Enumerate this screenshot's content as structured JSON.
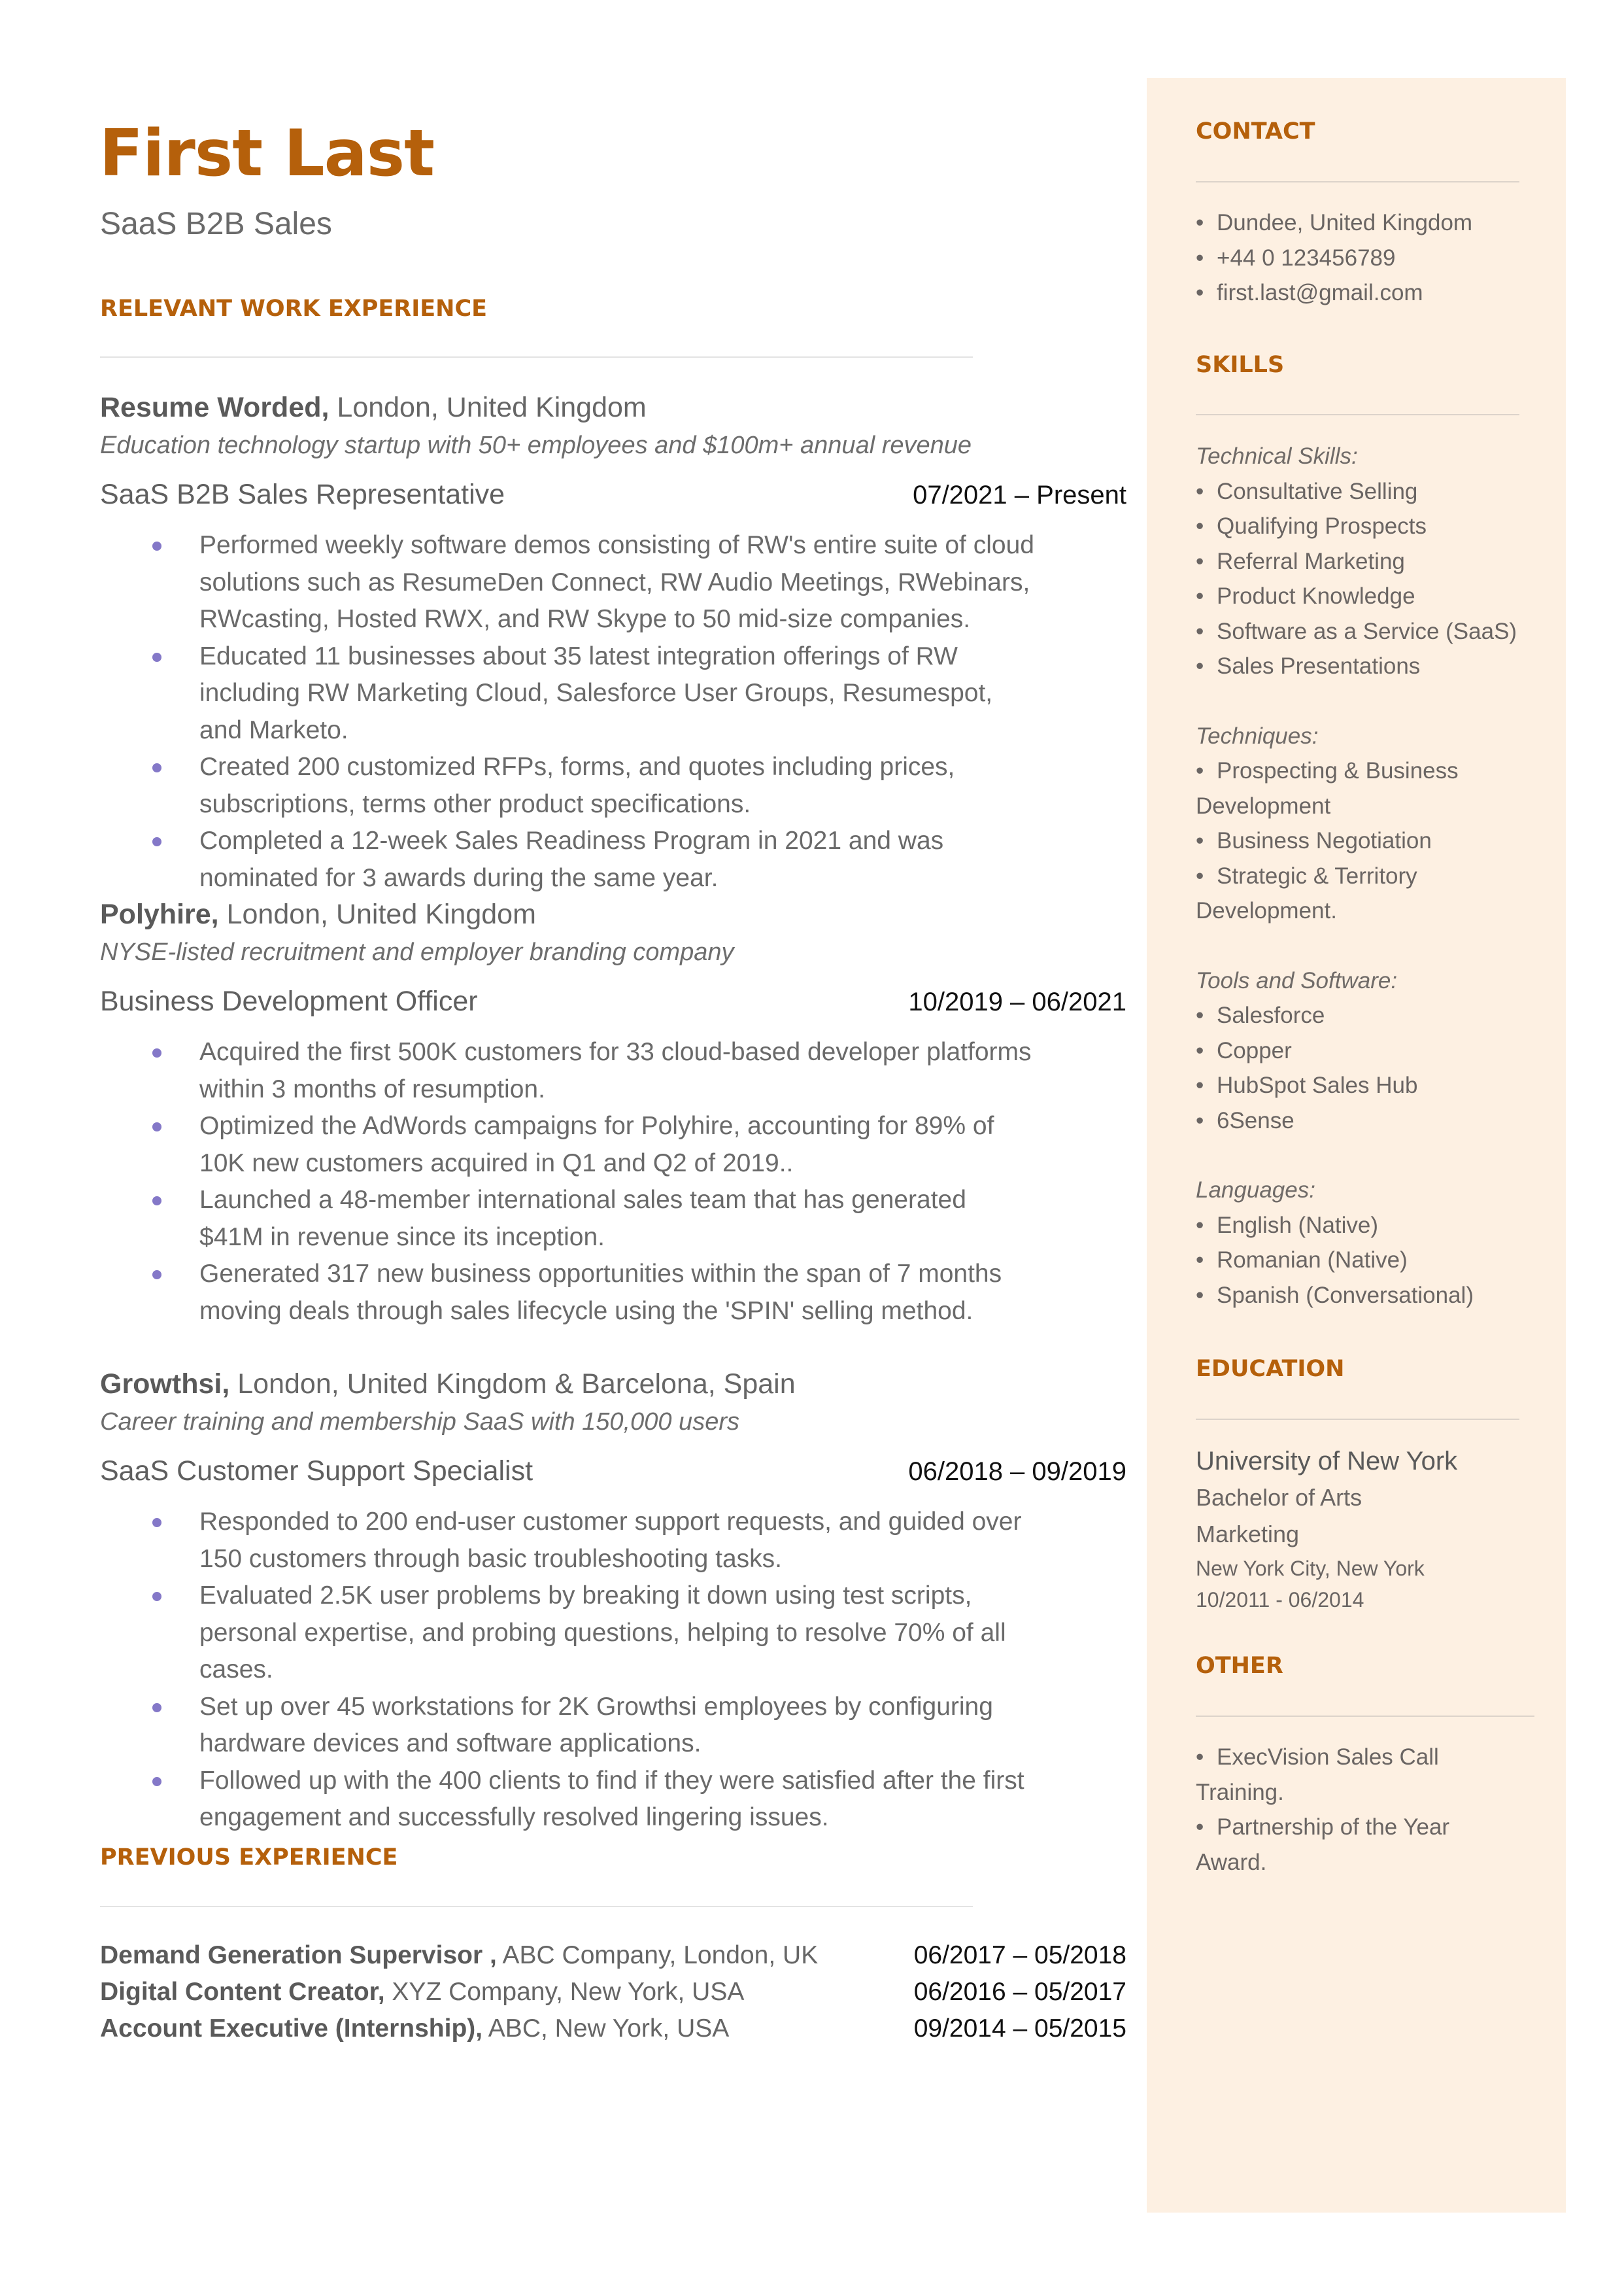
{
  "header": {
    "name": "First Last",
    "subtitle": "SaaS B2B Sales"
  },
  "colors": {
    "accent": "#b5600b",
    "bullet": "#8478c8",
    "sidebar_bg": "#fdf0e2",
    "text": "#5f5f5f"
  },
  "sections": {
    "relevant_work": "RELEVANT WORK EXPERIENCE",
    "previous": "PREVIOUS EXPERIENCE",
    "contact": "CONTACT",
    "skills": "SKILLS",
    "education": "EDUCATION",
    "other": "OTHER"
  },
  "experience": [
    {
      "company": "Resume Worded,",
      "location": " London, United Kingdom",
      "description": "Education technology startup with 50+ employees and $100m+ annual revenue",
      "role": "SaaS B2B Sales Representative",
      "dates": "07/2021 – Present",
      "bullets": [
        "Performed weekly software demos consisting of RW's entire suite of cloud solutions such as ResumeDen Connect, RW Audio Meetings, RWebinars, RWcasting, Hosted RWX, and RW Skype to 50 mid-size companies.",
        "Educated 11 businesses about 35 latest integration offerings of RW including RW Marketing Cloud, Salesforce User Groups, Resumespot, and Marketo.",
        "Created 200 customized RFPs, forms, and quotes including prices, subscriptions, terms other product specifications.",
        "Completed a 12-week Sales Readiness Program in 2021 and was nominated for 3 awards during the same year."
      ]
    },
    {
      "company": "Polyhire,",
      "location": " London, United Kingdom",
      "description": "NYSE-listed recruitment and employer branding company",
      "role": "Business Development Officer",
      "dates": "10/2019 – 06/2021",
      "bullets": [
        "Acquired the first 500K customers for 33 cloud-based developer platforms within 3 months of resumption.",
        "Optimized the AdWords campaigns for Polyhire, accounting for 89% of 10K new customers acquired in Q1 and Q2 of 2019..",
        "Launched a 48-member international sales team that has generated $41M in revenue since its inception.",
        "Generated 317 new business opportunities within the span of 7 months moving deals through sales lifecycle using the 'SPIN' selling method."
      ]
    },
    {
      "company": "Growthsi,",
      "location": " London, United Kingdom & Barcelona, Spain",
      "description": "Career training and membership SaaS with 150,000 users",
      "role": "SaaS Customer Support Specialist",
      "dates": "06/2018 – 09/2019",
      "bullets": [
        "Responded to 200 end-user customer support requests, and guided over 150 customers through basic troubleshooting tasks.",
        "Evaluated 2.5K user problems by breaking it down using test scripts, personal expertise, and probing questions, helping to resolve 70% of all cases.",
        "Set up over 45 workstations for 2K Growthsi employees by configuring hardware devices and software applications.",
        "Followed up with the 400 clients to find if they were satisfied after the first engagement and successfully resolved lingering issues."
      ]
    }
  ],
  "previous_experience": [
    {
      "title": "Demand Generation Supervisor ,",
      "org": " ABC Company, London, UK",
      "dates": "06/2017 – 05/2018"
    },
    {
      "title": "Digital Content Creator,",
      "org": " XYZ Company, New York, USA",
      "dates": "06/2016 – 05/2017"
    },
    {
      "title": "Account Executive (Internship),",
      "org": " ABC, New York, USA",
      "dates": "09/2014 – 05/2015"
    }
  ],
  "contact": {
    "items": [
      "Dundee, United Kingdom",
      "+44 0 123456789",
      "first.last@gmail.com"
    ]
  },
  "skills": {
    "technical_label": "Technical Skills:",
    "technical": [
      "Consultative Selling",
      "Qualifying Prospects",
      "Referral Marketing",
      "Product Knowledge",
      "Software as a Service (SaaS)",
      "Sales Presentations"
    ],
    "techniques_label": "Techniques:",
    "techniques": [
      "Prospecting & Business Development",
      "Business Negotiation",
      "Strategic & Territory Development."
    ],
    "tools_label": "Tools and Software:",
    "tools": [
      "Salesforce",
      "Copper",
      "HubSpot Sales Hub",
      "6Sense"
    ],
    "languages_label": "Languages:",
    "languages": [
      "English (Native)",
      "Romanian (Native)",
      "Spanish (Conversational)"
    ]
  },
  "education": {
    "school": "University of New York",
    "degree": "Bachelor of Arts",
    "major": "Marketing",
    "location": "New York City, New York",
    "dates": "10/2011 - 06/2014"
  },
  "other": {
    "items": [
      "ExecVision Sales Call Training.",
      "Partnership of the Year Award."
    ]
  },
  "icons": {
    "bullet": "•"
  }
}
